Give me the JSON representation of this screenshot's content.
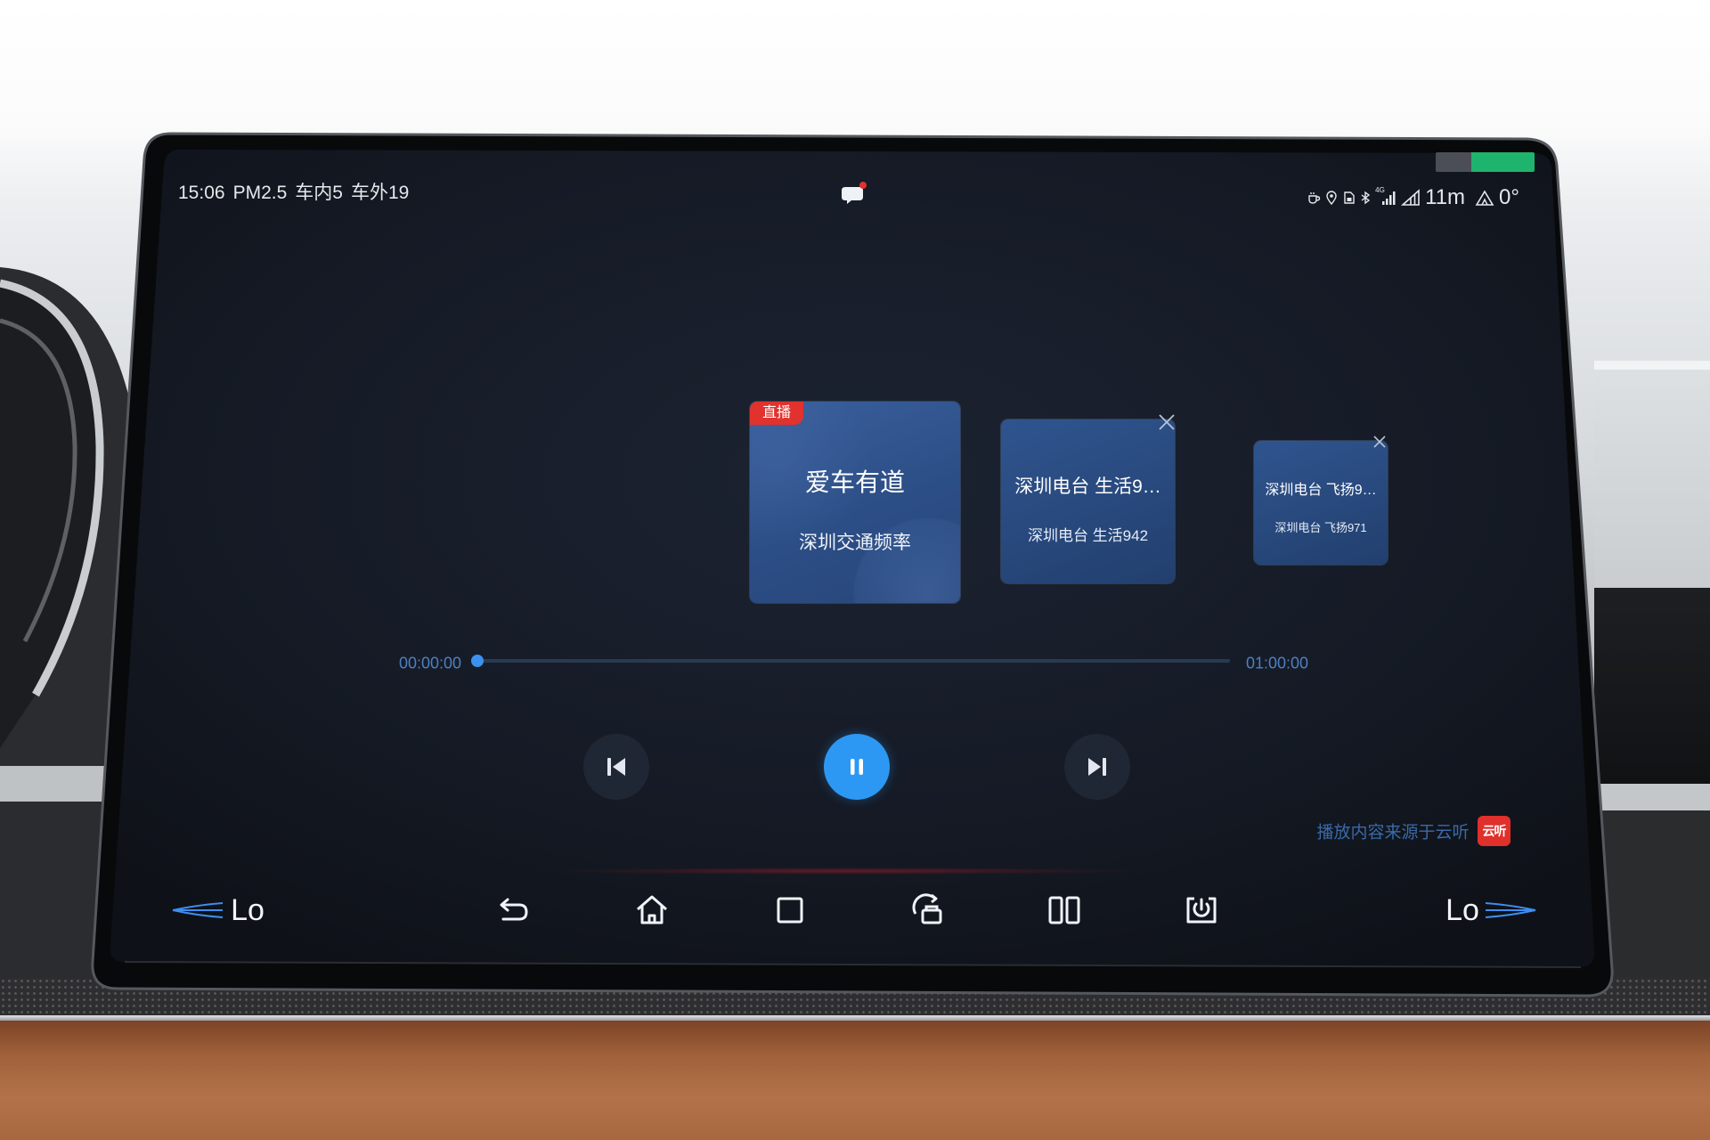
{
  "status_bar": {
    "time": "15:06",
    "pm25": "PM2.5",
    "temp_inside": "车内5",
    "temp_outside": "车外19",
    "network": "4G",
    "icons": [
      "cup-icon",
      "location-icon",
      "sim-card-icon",
      "bluetooth-icon",
      "cellular-signal-icon",
      "slope-icon",
      "altitude-icon"
    ],
    "distance": "11m",
    "angle": "0°"
  },
  "notification": {
    "icon": "chat-bubble-icon",
    "has_unread": true
  },
  "cards": [
    {
      "badge": "直播",
      "title": "爱车有道",
      "subtitle": "深圳交通频率"
    },
    {
      "title": "深圳电台 生活9…",
      "subtitle": "深圳电台 生活942"
    },
    {
      "title": "深圳电台 飞扬9…",
      "subtitle": "深圳电台 飞扬971"
    }
  ],
  "player": {
    "elapsed": "00:00:00",
    "total": "01:00:00",
    "progress": 0
  },
  "controls": {
    "previous": "skip-previous-icon",
    "play_pause": "pause-icon",
    "next": "skip-next-icon"
  },
  "source": {
    "text": "播放内容来源于云听",
    "logo_text": "云听"
  },
  "nav_bar": {
    "left_climate": "Lo",
    "right_climate": "Lo",
    "buttons": [
      "back-icon",
      "home-icon",
      "recent-apps-icon",
      "car-settings-icon",
      "split-screen-icon",
      "screen-power-icon"
    ]
  },
  "colors": {
    "accent": "#2d98f3",
    "live_badge": "#e1322d",
    "card": "#28497d",
    "progress_track": "#2a3a55"
  }
}
